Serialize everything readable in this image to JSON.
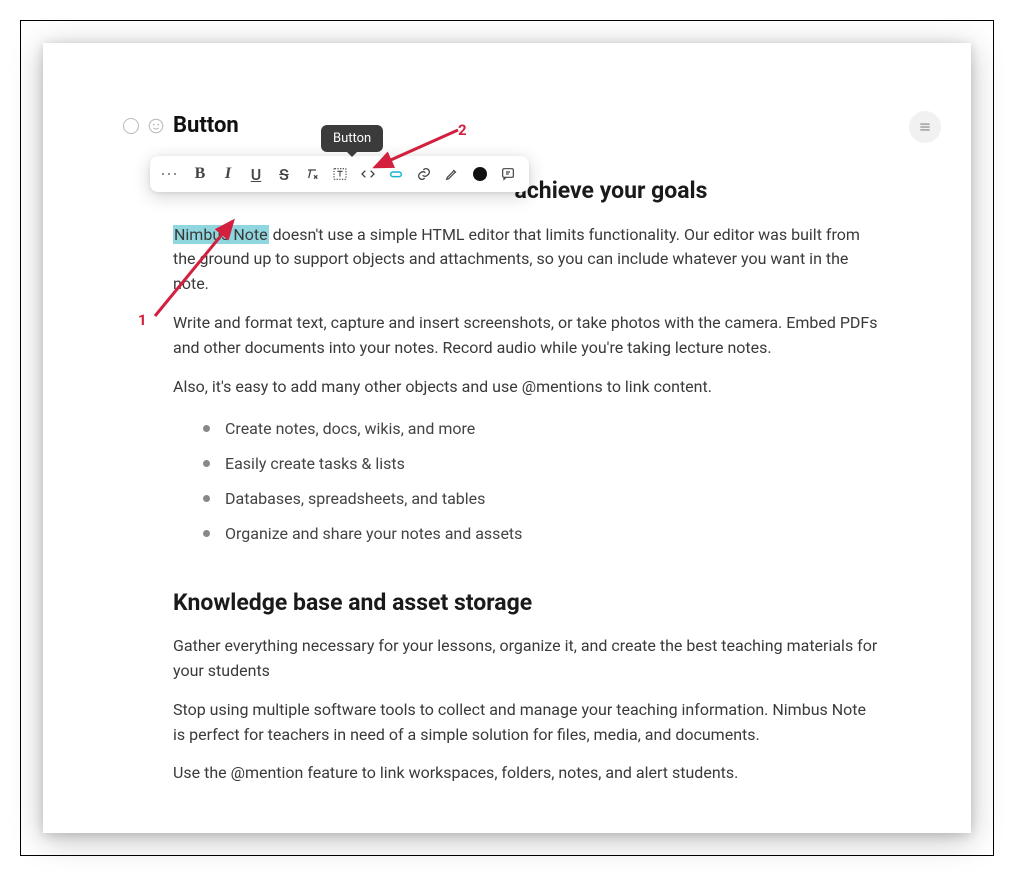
{
  "page_title": "Button",
  "tooltip_label": "Button",
  "heading1_suffix": "achieve your goals",
  "selected_text": "Nimbus Note",
  "para1_rest": " doesn't use a simple HTML editor that limits functionality. Our editor was built from the ground up to support objects and attachments, so you can include whatever you want in the note.",
  "para2": "Write and format text, capture and insert screenshots, or take photos with the camera. Embed PDFs and other documents into your notes. Record audio while you're taking lecture notes.",
  "para3": "Also, it's easy to add many other objects and use @mentions to link content.",
  "bullets": [
    "Create notes, docs, wikis, and more",
    "Easily create tasks & lists",
    "Databases, spreadsheets, and tables",
    "Organize and share your notes and assets"
  ],
  "heading2": "Knowledge base and asset storage",
  "para4": "Gather everything necessary for your lessons, organize it, and create the best teaching materials for your students",
  "para5": "Stop using multiple software tools to collect and manage your teaching information. Nimbus Note is perfect for teachers in need of a simple solution for files, media, and documents.",
  "para6": "Use the @mention feature to link workspaces, folders, notes, and alert students.",
  "annotations": {
    "num1": "1",
    "num2": "2"
  }
}
